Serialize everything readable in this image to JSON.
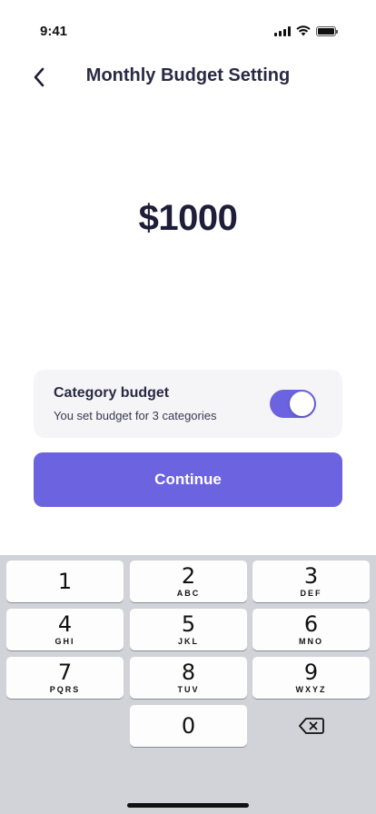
{
  "status_bar": {
    "time": "9:41"
  },
  "header": {
    "title": "Monthly Budget Setting",
    "back_icon": "chevron-left-icon"
  },
  "amount": {
    "display": "$1000"
  },
  "category_card": {
    "title": "Category budget",
    "subtitle": "You set budget for 3 categories",
    "toggle_on": true
  },
  "continue_label": "Continue",
  "keypad": {
    "keys": [
      {
        "num": "1",
        "letters": ""
      },
      {
        "num": "2",
        "letters": "ABC"
      },
      {
        "num": "3",
        "letters": "DEF"
      },
      {
        "num": "4",
        "letters": "GHI"
      },
      {
        "num": "5",
        "letters": "JKL"
      },
      {
        "num": "6",
        "letters": "MNO"
      },
      {
        "num": "7",
        "letters": "PQRS"
      },
      {
        "num": "8",
        "letters": "TUV"
      },
      {
        "num": "9",
        "letters": "WXYZ"
      },
      {
        "num": "0",
        "letters": ""
      }
    ],
    "backspace_icon": "backspace-icon"
  },
  "colors": {
    "accent": "#6C63E0",
    "title_text": "#2A2944",
    "keypad_bg": "#D1D3D9",
    "card_bg": "#F5F5F8"
  }
}
